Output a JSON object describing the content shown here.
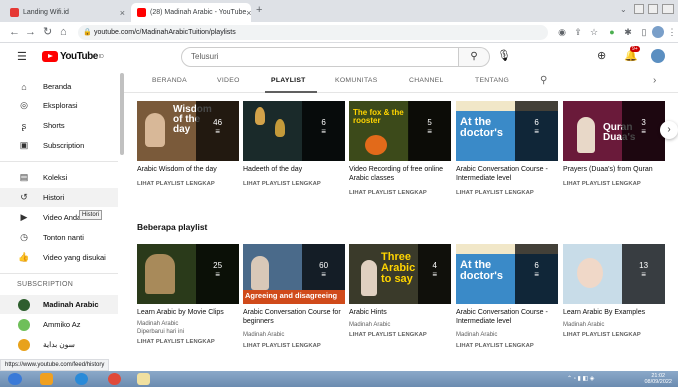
{
  "browser": {
    "tabs": [
      {
        "title": "Landing Wifi.id",
        "close": "×"
      },
      {
        "title": "(28) Madinah Arabic - YouTube",
        "close": "×"
      }
    ],
    "new_tab": "+",
    "url": "youtube.com/c/MadinahArabicTuition/playlists",
    "status_url": "https://www.youtube.com/feed/history"
  },
  "header": {
    "logo_text": "YouTube",
    "logo_sup": "ID",
    "search_value": "Telusuri",
    "notif_badge": "9+"
  },
  "sidebar": {
    "items": [
      {
        "label": "Beranda",
        "icon": "⌂"
      },
      {
        "label": "Eksplorasi",
        "icon": "◎"
      },
      {
        "label": "Shorts",
        "icon": "ʂ"
      },
      {
        "label": "Subscription",
        "icon": "▣"
      },
      {
        "label": "Koleksi",
        "icon": "▤"
      },
      {
        "label": "Histori",
        "icon": "↺"
      },
      {
        "label": "Video Anda",
        "icon": "▶"
      },
      {
        "label": "Tonton nanti",
        "icon": "◷"
      },
      {
        "label": "Video yang disukai",
        "icon": "👍"
      }
    ],
    "subscription_heading": "SUBSCRIPTION",
    "subscriptions": [
      {
        "label": "Madinah Arabic",
        "color": "#2e5e2e"
      },
      {
        "label": "Ammiko Az",
        "color": "#6fbf5a"
      },
      {
        "label": "ﺳﻮﻥ ﺑﺪﺍﻳﺔ",
        "color": "#e8a21b"
      }
    ],
    "tooltip": "Histori"
  },
  "channel_tabs": [
    "BERANDA",
    "VIDEO",
    "PLAYLIST",
    "KOMUNITAS",
    "CHANNEL",
    "TENTANG"
  ],
  "active_tab": "PLAYLIST",
  "row1": [
    {
      "title": "Arabic Wisdom of the day",
      "title2": "",
      "count": "46",
      "link": "LIHAT PLAYLIST LENGKAP",
      "deco": "Wisdom of the day",
      "bg": "#7a5a3a"
    },
    {
      "title": "Hadeeth of the day",
      "title2": "",
      "count": "6",
      "link": "LIHAT PLAYLIST LENGKAP",
      "deco": "",
      "bg": "#1a2a2a"
    },
    {
      "title": "Video Recording of free online",
      "title2": "Arabic classes",
      "count": "5",
      "link": "LIHAT PLAYLIST LENGKAP",
      "deco": "The fox & the rooster",
      "bg": "#2b2b1a"
    },
    {
      "title": "Arabic Conversation Course -",
      "title2": "Intermediate level",
      "count": "6",
      "link": "LIHAT PLAYLIST LENGKAP",
      "deco": "At the doctor's",
      "bg": "#3a8ac8"
    },
    {
      "title": "Prayers (Duaa's) from Quran",
      "title2": "",
      "count": "3",
      "link": "LIHAT PLAYLIST LENGKAP",
      "deco": "Quran Duaa's",
      "bg": "#6a1a3a"
    }
  ],
  "section_title": "Beberapa playlist",
  "row2": [
    {
      "title": "Learn Arabic by Movie Clips",
      "title2": "",
      "sub1": "Madinah Arabic",
      "sub2": "Diperbarui hari ini",
      "count": "25",
      "link": "LIHAT PLAYLIST LENGKAP",
      "deco": "",
      "bg": "#2a3a1a"
    },
    {
      "title": "Arabic Conversation Course for",
      "title2": "beginners",
      "sub1": "Madinah Arabic",
      "sub2": "",
      "count": "60",
      "link": "LIHAT PLAYLIST LENGKAP",
      "deco": "Agreeing and disagreeing",
      "bg": "#4a6a8a"
    },
    {
      "title": "Arabic Hints",
      "title2": "",
      "sub1": "Madinah Arabic",
      "sub2": "",
      "count": "4",
      "link": "LIHAT PLAYLIST LENGKAP",
      "deco": "Three Arabic to say",
      "bg": "#3a3a2a"
    },
    {
      "title": "Arabic Conversation Course -",
      "title2": "Intermediate level",
      "sub1": "Madinah Arabic",
      "sub2": "",
      "count": "6",
      "link": "LIHAT PLAYLIST LENGKAP",
      "deco": "At the doctor's",
      "bg": "#3a8ac8"
    },
    {
      "title": "Learn Arabic By Examples",
      "title2": "",
      "sub1": "Madinah Arabic",
      "sub2": "",
      "count": "13",
      "link": "LIHAT PLAYLIST LENGKAP",
      "deco": "",
      "bg": "#c8dce8"
    }
  ],
  "taskbar": {
    "time": "21:02",
    "date": "08/09/2022"
  },
  "colors": {
    "yt_red": "#ff0000",
    "text": "#0f0f0f",
    "muted": "#606060"
  }
}
